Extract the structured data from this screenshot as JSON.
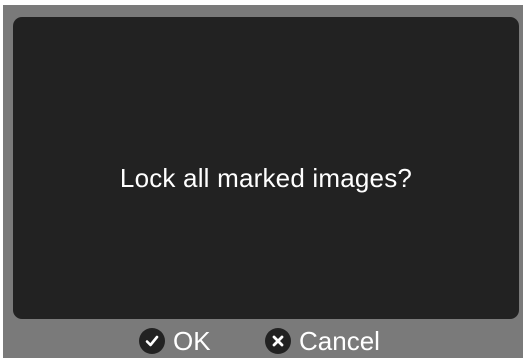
{
  "dialog": {
    "message": "Lock all marked images?"
  },
  "softkeys": {
    "ok_label": "OK",
    "ok_icon": "check-icon",
    "cancel_label": "Cancel",
    "cancel_icon": "close-icon"
  },
  "colors": {
    "frame": "#7a7a7a",
    "screen": "#222222",
    "text": "#ffffff"
  }
}
